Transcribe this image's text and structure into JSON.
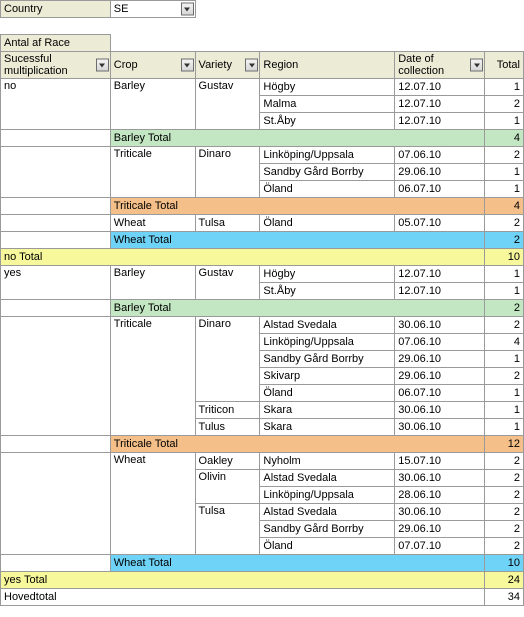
{
  "top": {
    "country_label": "Country",
    "country_value": "SE",
    "pivot_title": "Antal af Race"
  },
  "headers": {
    "mul": "Sucessful multiplication",
    "crop": "Crop",
    "variety": "Variety",
    "region": "Region",
    "date": "Date of collection",
    "total": "Total"
  },
  "groups": {
    "no": {
      "label": "no",
      "barley": {
        "crop": "Barley",
        "variety": "Gustav",
        "rows": [
          {
            "region": "Högby",
            "date": "12.07.10",
            "total": 1
          },
          {
            "region": "Malma",
            "date": "12.07.10",
            "total": 2
          },
          {
            "region": "St.Åby",
            "date": "12.07.10",
            "total": 1
          }
        ],
        "subtotal_label": "Barley Total",
        "subtotal": 4
      },
      "triticale": {
        "crop": "Triticale",
        "variety": "Dinaro",
        "rows": [
          {
            "region": "Linköping/Uppsala",
            "date": "07.06.10",
            "total": 2
          },
          {
            "region": "Sandby Gård Borrby",
            "date": "29.06.10",
            "total": 1
          },
          {
            "region": "Öland",
            "date": "06.07.10",
            "total": 1
          }
        ],
        "subtotal_label": "Triticale Total",
        "subtotal": 4
      },
      "wheat": {
        "crop": "Wheat",
        "variety": "Tulsa",
        "rows": [
          {
            "region": "Öland",
            "date": "05.07.10",
            "total": 2
          }
        ],
        "subtotal_label": "Wheat Total",
        "subtotal": 2
      },
      "total_label": "no Total",
      "total": 10
    },
    "yes": {
      "label": "yes",
      "barley": {
        "crop": "Barley",
        "variety": "Gustav",
        "rows": [
          {
            "region": "Högby",
            "date": "12.07.10",
            "total": 1
          },
          {
            "region": "St.Åby",
            "date": "12.07.10",
            "total": 1
          }
        ],
        "subtotal_label": "Barley Total",
        "subtotal": 2
      },
      "triticale": {
        "crop": "Triticale",
        "v1": "Dinaro",
        "v1rows": [
          {
            "region": "Alstad Svedala",
            "date": "30.06.10",
            "total": 2
          },
          {
            "region": "Linköping/Uppsala",
            "date": "07.06.10",
            "total": 4
          },
          {
            "region": "Sandby Gård Borrby",
            "date": "29.06.10",
            "total": 1
          },
          {
            "region": "Skivarp",
            "date": "29.06.10",
            "total": 2
          },
          {
            "region": "Öland",
            "date": "06.07.10",
            "total": 1
          }
        ],
        "v2": "Triticon",
        "v2rows": [
          {
            "region": "Skara",
            "date": "30.06.10",
            "total": 1
          }
        ],
        "v3": "Tulus",
        "v3rows": [
          {
            "region": "Skara",
            "date": "30.06.10",
            "total": 1
          }
        ],
        "subtotal_label": "Triticale Total",
        "subtotal": 12
      },
      "wheat": {
        "crop": "Wheat",
        "v1": "Oakley",
        "v1rows": [
          {
            "region": "Nyholm",
            "date": "15.07.10",
            "total": 2
          }
        ],
        "v2": "Olivin",
        "v2rows": [
          {
            "region": "Alstad Svedala",
            "date": "30.06.10",
            "total": 2
          },
          {
            "region": "Linköping/Uppsala",
            "date": "28.06.10",
            "total": 2
          }
        ],
        "v3": "Tulsa",
        "v3rows": [
          {
            "region": "Alstad Svedala",
            "date": "30.06.10",
            "total": 2
          },
          {
            "region": "Sandby Gård Borrby",
            "date": "29.06.10",
            "total": 2
          },
          {
            "region": "Öland",
            "date": "07.07.10",
            "total": 2
          }
        ],
        "subtotal_label": "Wheat Total",
        "subtotal": 10
      },
      "total_label": "yes Total",
      "total": 24
    }
  },
  "grand": {
    "label": "Hovedtotal",
    "total": 34
  }
}
